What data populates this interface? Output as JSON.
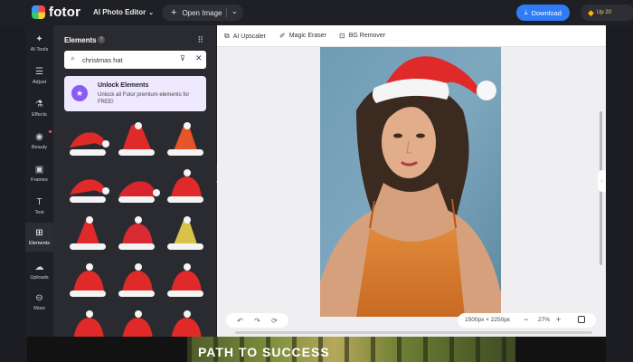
{
  "header": {
    "logo_text": "fotor",
    "editor_menu": "AI Photo Editor",
    "open_image": "Open Image",
    "download": "Download",
    "upgrade": "Up 20"
  },
  "rail": {
    "items": [
      {
        "label": "AI Tools",
        "icon": "sparkle-icon"
      },
      {
        "label": "Adjust",
        "icon": "sliders-icon"
      },
      {
        "label": "Effects",
        "icon": "flask-icon"
      },
      {
        "label": "Beauty",
        "icon": "eye-icon"
      },
      {
        "label": "Frames",
        "icon": "frame-icon"
      },
      {
        "label": "Text",
        "icon": "text-icon"
      },
      {
        "label": "Elements",
        "icon": "shapes-icon"
      },
      {
        "label": "Uploads",
        "icon": "cloud-upload-icon"
      },
      {
        "label": "More",
        "icon": "more-icon"
      }
    ]
  },
  "panel": {
    "title": "Elements",
    "search_value": "christmas hat",
    "unlock_title": "Unlock Elements",
    "unlock_desc": "Unlock all Fotor premium elements for FREE!"
  },
  "toolbar": {
    "upscaler": "AI Upscaler",
    "magic_eraser": "Magic Eraser",
    "bg_remover": "BG Remover"
  },
  "status": {
    "dimensions": "1500px × 2250px",
    "zoom": "27%"
  },
  "banner": {
    "text": "PATH TO SUCCESS"
  },
  "colors": {
    "accent": "#2f7cf6",
    "premium": "#8a5cf5",
    "hat_red": "#e02a2a"
  }
}
